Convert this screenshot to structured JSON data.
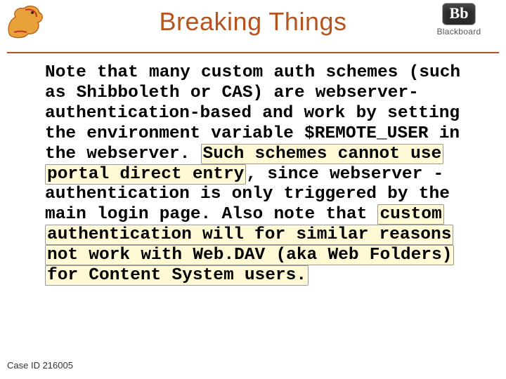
{
  "header": {
    "title": "Breaking Things",
    "brand_mark": "Bb",
    "brand_name": "Blackboard"
  },
  "body": {
    "pre1": "Note that many custom auth schemes (such as Shibboleth or CAS) are webserver-authentication-based and work by setting the environment variable $REMOTE_USER in the webserver. ",
    "hl1": "Such schemes cannot use portal direct entry",
    "mid1": ", since webserver -authentication is only triggered by the main login page. Also note that ",
    "hl2": "custom authentication will for similar reasons not work with Web.DAV (aka Web Folders) for Content System users."
  },
  "footer": {
    "case_id": "Case ID 216005"
  }
}
